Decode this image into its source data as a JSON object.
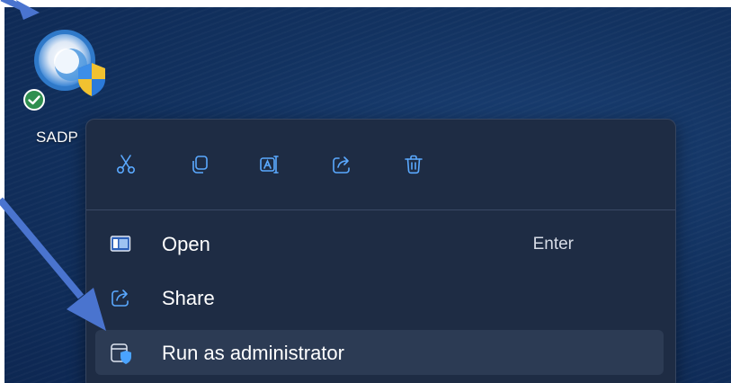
{
  "desktop_icon": {
    "label": "SADP",
    "icon": "sadp-app-icon",
    "overlay": "sync-ok-check-icon"
  },
  "context_menu": {
    "quick_actions": [
      {
        "name": "cut",
        "icon": "scissors-icon"
      },
      {
        "name": "copy",
        "icon": "copy-icon"
      },
      {
        "name": "rename",
        "icon": "rename-icon"
      },
      {
        "name": "share",
        "icon": "share-icon"
      },
      {
        "name": "delete",
        "icon": "trash-icon"
      }
    ],
    "items": [
      {
        "label": "Open",
        "shortcut": "Enter",
        "icon": "open-window-icon"
      },
      {
        "label": "Share",
        "icon": "share-icon"
      },
      {
        "label": "Run as administrator",
        "icon": "admin-shield-icon",
        "highlighted": true
      }
    ]
  },
  "colors": {
    "desktop_bg": "#123260",
    "menu_bg": "#1e2c44",
    "highlight_bg": "#2c3b54",
    "arrow": "#4a74cf",
    "accent_blue": "#4aa3ff"
  }
}
